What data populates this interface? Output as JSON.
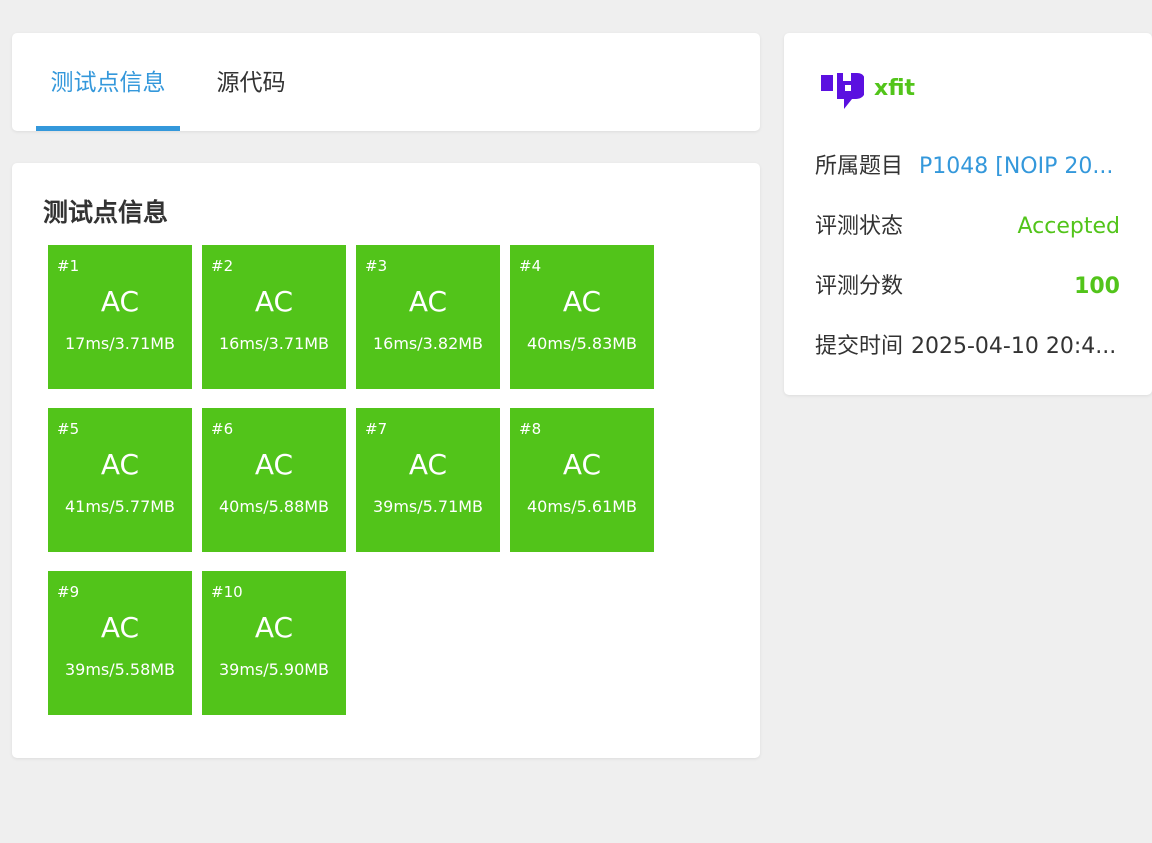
{
  "tabs": [
    {
      "label": "测试点信息",
      "active": true
    },
    {
      "label": "源代码",
      "active": false
    }
  ],
  "testcases": {
    "title": "测试点信息",
    "items": [
      {
        "num": "#1",
        "status": "AC",
        "usage": "17ms/3.71MB"
      },
      {
        "num": "#2",
        "status": "AC",
        "usage": "16ms/3.71MB"
      },
      {
        "num": "#3",
        "status": "AC",
        "usage": "16ms/3.82MB"
      },
      {
        "num": "#4",
        "status": "AC",
        "usage": "40ms/5.83MB"
      },
      {
        "num": "#5",
        "status": "AC",
        "usage": "41ms/5.77MB"
      },
      {
        "num": "#6",
        "status": "AC",
        "usage": "40ms/5.88MB"
      },
      {
        "num": "#7",
        "status": "AC",
        "usage": "39ms/5.71MB"
      },
      {
        "num": "#8",
        "status": "AC",
        "usage": "40ms/5.61MB"
      },
      {
        "num": "#9",
        "status": "AC",
        "usage": "39ms/5.58MB"
      },
      {
        "num": "#10",
        "status": "AC",
        "usage": "39ms/5.90MB"
      }
    ]
  },
  "info": {
    "user": {
      "name": "xfit",
      "avatar_icon": "user-logo-icon"
    },
    "problem_label": "所属题目",
    "problem_value": "P1048 [NOIP 20...",
    "status_label": "评测状态",
    "status_value": "Accepted",
    "score_label": "评测分数",
    "score_value": "100",
    "time_label": "提交时间",
    "time_value": "2025-04-10 20:4..."
  },
  "colors": {
    "accent": "#3498db",
    "accepted": "#52c41a",
    "logo": "#5b10e0",
    "background": "#efefef"
  }
}
